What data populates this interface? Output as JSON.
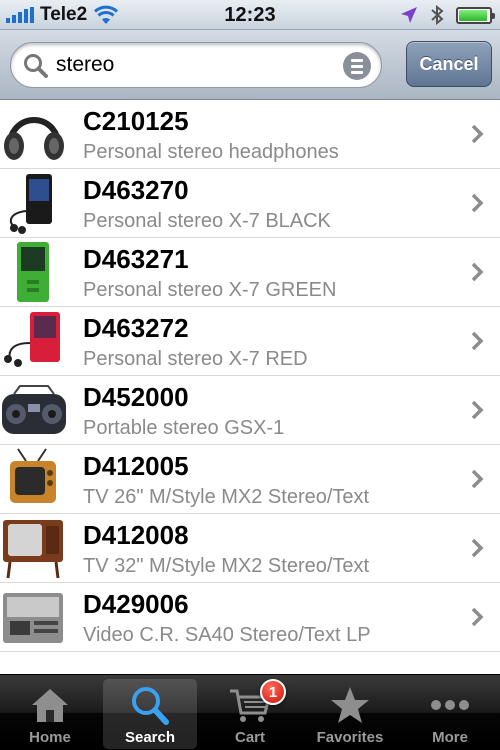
{
  "status_bar": {
    "carrier": "Tele2",
    "time": "12:23",
    "battery_level": 0.95
  },
  "search": {
    "query": "stereo",
    "cancel_label": "Cancel"
  },
  "results": [
    {
      "code": "C210125",
      "description": "Personal stereo headphones",
      "icon": "headphones-icon"
    },
    {
      "code": "D463270",
      "description": "Personal stereo X-7 BLACK",
      "icon": "media-player-black-icon"
    },
    {
      "code": "D463271",
      "description": "Personal stereo X-7 GREEN",
      "icon": "media-player-green-icon"
    },
    {
      "code": "D463272",
      "description": "Personal stereo X-7 RED",
      "icon": "media-player-red-icon"
    },
    {
      "code": "D452000",
      "description": "Portable stereo GSX-1",
      "icon": "boombox-icon"
    },
    {
      "code": "D412005",
      "description": "TV 26\" M/Style MX2 Stereo/Text",
      "icon": "retro-tv-icon"
    },
    {
      "code": "D412008",
      "description": "TV 32\" M/Style MX2 Stereo/Text",
      "icon": "wooden-tv-icon"
    },
    {
      "code": "D429006",
      "description": "Video C.R. SA40 Stereo/Text LP",
      "icon": "video-recorder-icon"
    }
  ],
  "tab_bar": {
    "tabs": [
      {
        "label": "Home",
        "icon": "home-icon"
      },
      {
        "label": "Search",
        "icon": "search-icon",
        "active": true
      },
      {
        "label": "Cart",
        "icon": "cart-icon",
        "badge": "1"
      },
      {
        "label": "Favorites",
        "icon": "star-icon"
      },
      {
        "label": "More",
        "icon": "more-icon"
      }
    ]
  },
  "colors": {
    "accent": "#1e6fd1",
    "badge": "#d0120a",
    "secondary_text": "#8a8a8a"
  }
}
